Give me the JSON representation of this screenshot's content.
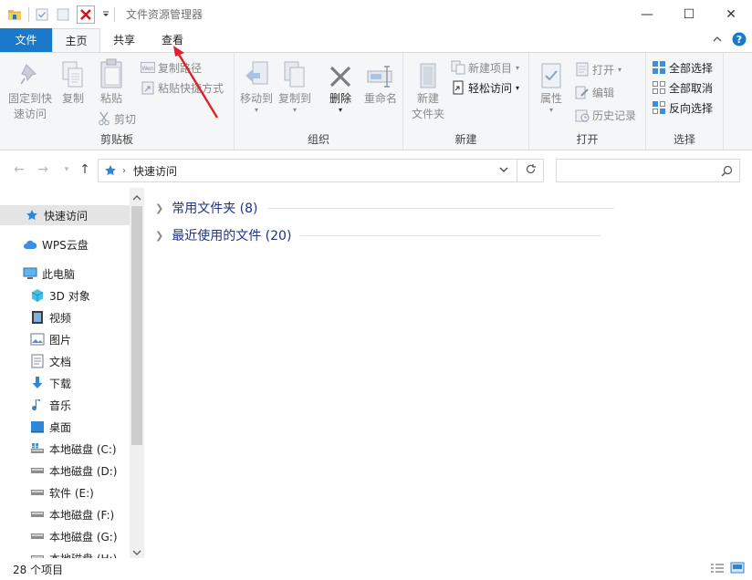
{
  "window": {
    "title": "文件资源管理器",
    "minimize_glyph": "—",
    "maximize_glyph": "☐",
    "close_glyph": "✕"
  },
  "ribbon_tabs": {
    "file": "文件",
    "home": "主页",
    "share": "共享",
    "view": "查看"
  },
  "ribbon": {
    "clipboard": {
      "label": "剪贴板",
      "pin_quick_access_line1": "固定到快",
      "pin_quick_access_line2": "速访问",
      "copy": "复制",
      "paste": "粘贴",
      "copy_path": "复制路径",
      "paste_shortcut": "粘贴快捷方式",
      "cut": "剪切"
    },
    "organize": {
      "label": "组织",
      "move_to": "移动到",
      "copy_to": "复制到",
      "delete": "删除",
      "rename": "重命名"
    },
    "new": {
      "label": "新建",
      "new_folder_line1": "新建",
      "new_folder_line2": "文件夹",
      "new_item": "新建项目",
      "easy_access": "轻松访问"
    },
    "open": {
      "label": "打开",
      "properties": "属性",
      "open": "打开",
      "edit": "编辑",
      "history": "历史记录"
    },
    "select": {
      "label": "选择",
      "select_all": "全部选择",
      "select_none": "全部取消",
      "invert_selection": "反向选择"
    }
  },
  "address_bar": {
    "path": "快速访问"
  },
  "nav_pane": {
    "items": [
      {
        "label": "快速访问",
        "icon": "quick-access-star-icon"
      },
      {
        "label": "WPS云盘",
        "icon": "cloud-icon"
      },
      {
        "label": "此电脑",
        "icon": "computer-icon"
      },
      {
        "label": "3D 对象",
        "icon": "3d-objects-icon"
      },
      {
        "label": "视频",
        "icon": "video-icon"
      },
      {
        "label": "图片",
        "icon": "pictures-icon"
      },
      {
        "label": "文档",
        "icon": "documents-icon"
      },
      {
        "label": "下载",
        "icon": "download-icon"
      },
      {
        "label": "音乐",
        "icon": "music-icon"
      },
      {
        "label": "桌面",
        "icon": "desktop-icon"
      },
      {
        "label": "本地磁盘 (C:)",
        "icon": "drive-icon"
      },
      {
        "label": "本地磁盘 (D:)",
        "icon": "drive-icon"
      },
      {
        "label": "软件 (E:)",
        "icon": "drive-icon"
      },
      {
        "label": "本地磁盘 (F:)",
        "icon": "drive-icon"
      },
      {
        "label": "本地磁盘 (G:)",
        "icon": "drive-icon"
      },
      {
        "label": "本地磁盘 (H:)",
        "icon": "drive-icon"
      }
    ]
  },
  "content": {
    "groups": [
      {
        "label": "常用文件夹 (8)"
      },
      {
        "label": "最近使用的文件 (20)"
      }
    ]
  },
  "status_bar": {
    "item_count": "28 个项目"
  },
  "colors": {
    "accent": "#1979ca",
    "group_header": "#1e3287",
    "annotation_arrow": "#e0202a"
  }
}
